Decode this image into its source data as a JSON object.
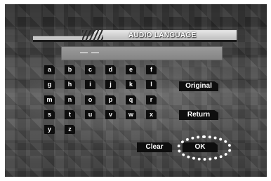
{
  "header": {
    "title": "AUDIO LANGUAGE"
  },
  "input": {
    "value": "— —"
  },
  "keyboard": {
    "keys": [
      "a",
      "b",
      "c",
      "d",
      "e",
      "f",
      "g",
      "h",
      "i",
      "j",
      "k",
      "l",
      "m",
      "n",
      "o",
      "p",
      "q",
      "r",
      "s",
      "t",
      "u",
      "v",
      "w",
      "x",
      "y",
      "z"
    ]
  },
  "buttons": {
    "original": "Original",
    "return": "Return",
    "clear": "Clear",
    "ok": "OK"
  },
  "focus": "OK"
}
